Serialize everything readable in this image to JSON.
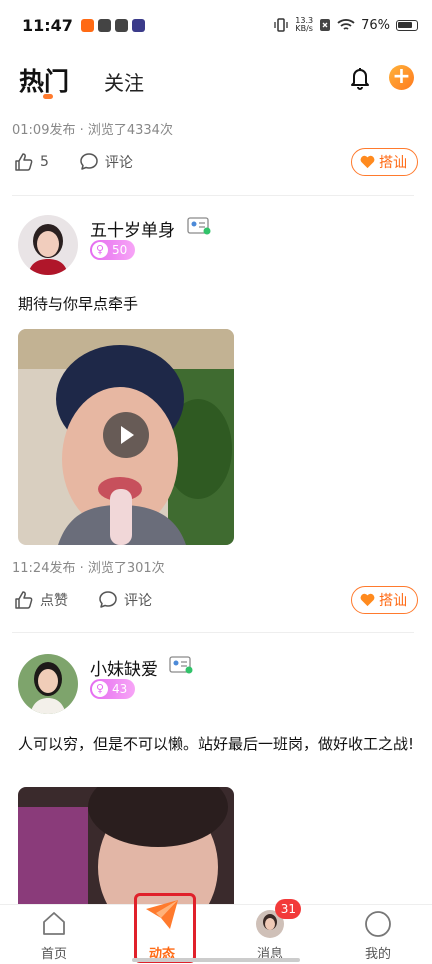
{
  "status_bar": {
    "time": "11:47",
    "speed_value": "13.3",
    "speed_unit": "KB/s",
    "battery": "76%"
  },
  "header": {
    "tab_hot": "热门",
    "tab_follow": "关注"
  },
  "post0": {
    "meta": "01:09发布 · 浏览了4334次",
    "likes": "5",
    "comment": "评论",
    "dashan": "搭讪"
  },
  "post1": {
    "name": "五十岁单身",
    "age": "50",
    "text": "期待与你早点牵手",
    "meta": "11:24发布 · 浏览了301次",
    "like": "点赞",
    "comment": "评论",
    "dashan": "搭讪"
  },
  "post2": {
    "name": "小妹缺爱",
    "age": "43",
    "text": "人可以穷，但是不可以懒。站好最后一班岗，做好收工之战!"
  },
  "nav": {
    "home": "首页",
    "moments": "动态",
    "messages": "消息",
    "messages_badge": "31",
    "mine": "我的"
  },
  "colors": {
    "accent": "#ff7a2d",
    "age_tag": "#e46cf0",
    "badge": "#f23a3a",
    "highlight": "#e0202a"
  }
}
